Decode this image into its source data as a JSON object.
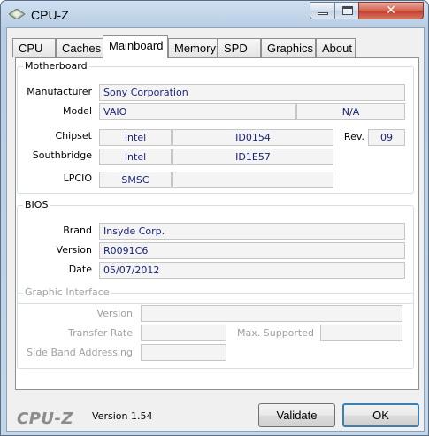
{
  "window": {
    "title": "CPU-Z"
  },
  "tabs": [
    "CPU",
    "Caches",
    "Mainboard",
    "Memory",
    "SPD",
    "Graphics",
    "About"
  ],
  "motherboard": {
    "group_title": "Motherboard",
    "manufacturer_label": "Manufacturer",
    "manufacturer": "Sony Corporation",
    "model_label": "Model",
    "model": "VAIO",
    "model_revision": "N/A",
    "chipset_label": "Chipset",
    "chipset_vendor": "Intel",
    "chipset_model": "ID0154",
    "rev_label": "Rev.",
    "rev": "09",
    "southbridge_label": "Southbridge",
    "southbridge_vendor": "Intel",
    "southbridge_model": "ID1E57",
    "lpcio_label": "LPCIO",
    "lpcio_vendor": "SMSC",
    "lpcio_model": ""
  },
  "bios": {
    "group_title": "BIOS",
    "brand_label": "Brand",
    "brand": "Insyde Corp.",
    "version_label": "Version",
    "version": "R0091C6",
    "date_label": "Date",
    "date": "05/07/2012"
  },
  "graphic_interface": {
    "group_title": "Graphic Interface",
    "version_label": "Version",
    "transfer_rate_label": "Transfer Rate",
    "max_supported_label": "Max. Supported",
    "side_band_label": "Side Band Addressing"
  },
  "footer": {
    "logo": "CPU-Z",
    "version": "Version 1.54",
    "validate_label": "Validate",
    "ok_label": "OK"
  },
  "colors": {
    "value_text": "#1a237e",
    "close_button": "#c13c28",
    "disabled_text": "#a0a0a0"
  },
  "icons": {
    "app": "cpu-z-app-icon",
    "minimize": "minimize-icon",
    "maximize": "maximize-icon",
    "close": "close-icon"
  }
}
